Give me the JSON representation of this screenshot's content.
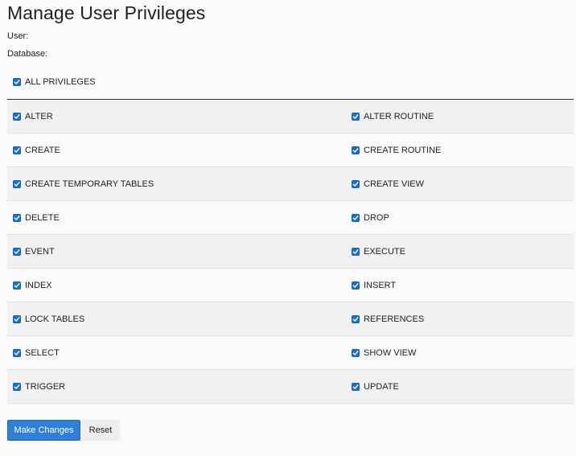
{
  "page": {
    "title": "Manage User Privileges",
    "user_label": "User:",
    "user_value": "",
    "database_label": "Database:",
    "database_value": ""
  },
  "all_privileges": {
    "label": "ALL PRIVILEGES",
    "checked": true
  },
  "privileges": [
    {
      "left": {
        "label": "ALTER",
        "checked": true
      },
      "right": {
        "label": "ALTER ROUTINE",
        "checked": true
      }
    },
    {
      "left": {
        "label": "CREATE",
        "checked": true
      },
      "right": {
        "label": "CREATE ROUTINE",
        "checked": true
      }
    },
    {
      "left": {
        "label": "CREATE TEMPORARY TABLES",
        "checked": true
      },
      "right": {
        "label": "CREATE VIEW",
        "checked": true
      }
    },
    {
      "left": {
        "label": "DELETE",
        "checked": true
      },
      "right": {
        "label": "DROP",
        "checked": true
      }
    },
    {
      "left": {
        "label": "EVENT",
        "checked": true
      },
      "right": {
        "label": "EXECUTE",
        "checked": true
      }
    },
    {
      "left": {
        "label": "INDEX",
        "checked": true
      },
      "right": {
        "label": "INSERT",
        "checked": true
      }
    },
    {
      "left": {
        "label": "LOCK TABLES",
        "checked": true
      },
      "right": {
        "label": "REFERENCES",
        "checked": true
      }
    },
    {
      "left": {
        "label": "SELECT",
        "checked": true
      },
      "right": {
        "label": "SHOW VIEW",
        "checked": true
      }
    },
    {
      "left": {
        "label": "TRIGGER",
        "checked": true
      },
      "right": {
        "label": "UPDATE",
        "checked": true
      }
    }
  ],
  "actions": {
    "submit_label": "Make Changes",
    "reset_label": "Reset"
  },
  "colors": {
    "checkbox": "#1a6fd0",
    "primary_button": "#2f7ed8",
    "row_shaded": "#f1f1f1"
  }
}
